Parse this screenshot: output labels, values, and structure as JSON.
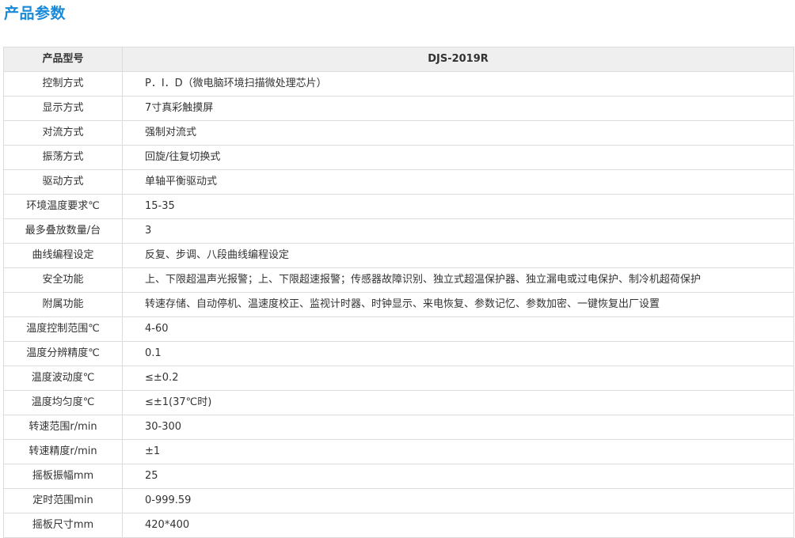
{
  "page": {
    "title": "产品参数"
  },
  "table": {
    "header": {
      "label": "产品型号",
      "value": "DJS-2019R"
    },
    "rows": [
      {
        "label": "控制方式",
        "value": "P．I．D（微电脑环境扫描微处理芯片）"
      },
      {
        "label": "显示方式",
        "value": "7寸真彩触摸屏"
      },
      {
        "label": "对流方式",
        "value": "强制对流式"
      },
      {
        "label": "振荡方式",
        "value": "回旋/往复切换式"
      },
      {
        "label": "驱动方式",
        "value": "单轴平衡驱动式"
      },
      {
        "label": "环境温度要求℃",
        "value": "15-35"
      },
      {
        "label": "最多叠放数量/台",
        "value": "3"
      },
      {
        "label": "曲线编程设定",
        "value": "反复、步调、八段曲线编程设定"
      },
      {
        "label": "安全功能",
        "value": "上、下限超温声光报警；上、下限超速报警；传感器故障识别、独立式超温保护器、独立漏电或过电保护、制冷机超荷保护"
      },
      {
        "label": "附属功能",
        "value": "转速存储、自动停机、温速度校正、监视计时器、时钟显示、来电恢复、参数记忆、参数加密、一键恢复出厂设置"
      },
      {
        "label": "温度控制范围℃",
        "value": "4-60"
      },
      {
        "label": "温度分辨精度℃",
        "value": "0.1"
      },
      {
        "label": "温度波动度℃",
        "value": "≤±0.2"
      },
      {
        "label": "温度均匀度℃",
        "value": "≤±1(37℃时)"
      },
      {
        "label": "转速范围r/min",
        "value": "30-300"
      },
      {
        "label": "转速精度r/min",
        "value": "±1"
      },
      {
        "label": "摇板振幅mm",
        "value": "25"
      },
      {
        "label": "定时范围min",
        "value": "0-999.59"
      },
      {
        "label": "摇板尺寸mm",
        "value": "420*400"
      }
    ]
  }
}
